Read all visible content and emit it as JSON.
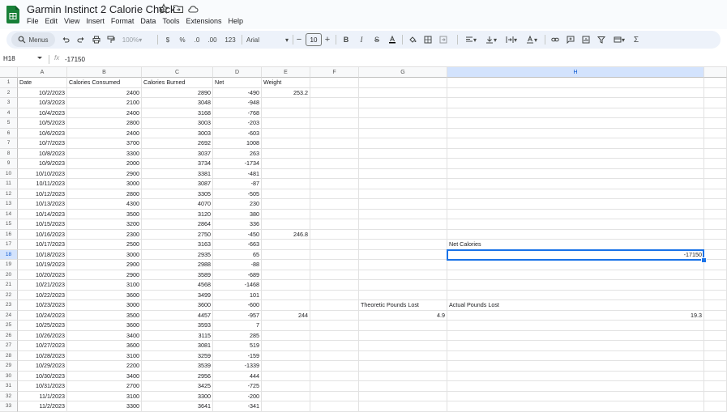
{
  "app": {
    "title": "Garmin Instinct 2 Calorie Check",
    "menus": [
      "File",
      "Edit",
      "View",
      "Insert",
      "Format",
      "Data",
      "Tools",
      "Extensions",
      "Help"
    ],
    "brand_color": "#188038"
  },
  "toolbar": {
    "menus_label": "Menus",
    "zoom": "100%",
    "currency": "$",
    "percent": "%",
    "dec_decrease": ".0",
    "dec_increase": ".00",
    "number_format": "123",
    "font": "Arial",
    "font_size": "10",
    "icons": [
      "undo-icon",
      "redo-icon",
      "print-icon",
      "paint-format-icon",
      "bold-icon",
      "italic-icon",
      "strikethrough-icon",
      "text-color-icon",
      "fill-color-icon",
      "borders-icon",
      "merge-icon",
      "h-align-icon",
      "v-align-icon",
      "wrap-icon",
      "rotate-icon",
      "link-icon",
      "comment-icon",
      "chart-icon",
      "filter-icon",
      "filter-views-icon",
      "functions-icon"
    ]
  },
  "formula_bar": {
    "name_box": "H18",
    "fx": "fx",
    "value": "-17150"
  },
  "grid": {
    "columns": [
      "A",
      "B",
      "C",
      "D",
      "E",
      "F",
      "G",
      "H"
    ],
    "selected_column": "H",
    "selected_row": "18",
    "row_numbers": [
      "1",
      "2",
      "3",
      "4",
      "5",
      "6",
      "7",
      "8",
      "9",
      "10",
      "11",
      "12",
      "13",
      "14",
      "15",
      "16",
      "17",
      "18",
      "19",
      "20",
      "21",
      "22",
      "23",
      "24",
      "25",
      "26",
      "27",
      "28",
      "29",
      "30",
      "31",
      "32",
      "33"
    ],
    "rows": [
      [
        "Date",
        "Calories Consumed",
        "Calories Burned",
        "Net",
        "Weight",
        "",
        "",
        ""
      ],
      [
        "10/2/2023",
        "2400",
        "2890",
        "-490",
        "253.2",
        "",
        "",
        ""
      ],
      [
        "10/3/2023",
        "2100",
        "3048",
        "-948",
        "",
        "",
        "",
        ""
      ],
      [
        "10/4/2023",
        "2400",
        "3168",
        "-768",
        "",
        "",
        "",
        ""
      ],
      [
        "10/5/2023",
        "2800",
        "3003",
        "-203",
        "",
        "",
        "",
        ""
      ],
      [
        "10/6/2023",
        "2400",
        "3003",
        "-603",
        "",
        "",
        "",
        ""
      ],
      [
        "10/7/2023",
        "3700",
        "2692",
        "1008",
        "",
        "",
        "",
        ""
      ],
      [
        "10/8/2023",
        "3300",
        "3037",
        "263",
        "",
        "",
        "",
        ""
      ],
      [
        "10/9/2023",
        "2000",
        "3734",
        "-1734",
        "",
        "",
        "",
        ""
      ],
      [
        "10/10/2023",
        "2900",
        "3381",
        "-481",
        "",
        "",
        "",
        ""
      ],
      [
        "10/11/2023",
        "3000",
        "3087",
        "-87",
        "",
        "",
        "",
        ""
      ],
      [
        "10/12/2023",
        "2800",
        "3305",
        "-505",
        "",
        "",
        "",
        ""
      ],
      [
        "10/13/2023",
        "4300",
        "4070",
        "230",
        "",
        "",
        "",
        ""
      ],
      [
        "10/14/2023",
        "3500",
        "3120",
        "380",
        "",
        "",
        "",
        ""
      ],
      [
        "10/15/2023",
        "3200",
        "2864",
        "336",
        "",
        "",
        "",
        ""
      ],
      [
        "10/16/2023",
        "2300",
        "2750",
        "-450",
        "246.8",
        "",
        "",
        ""
      ],
      [
        "10/17/2023",
        "2500",
        "3163",
        "-663",
        "",
        "",
        "",
        "Net Calories"
      ],
      [
        "10/18/2023",
        "3000",
        "2935",
        "65",
        "",
        "",
        "",
        "-17150"
      ],
      [
        "10/19/2023",
        "2900",
        "2988",
        "-88",
        "",
        "",
        "",
        ""
      ],
      [
        "10/20/2023",
        "2900",
        "3589",
        "-689",
        "",
        "",
        "",
        ""
      ],
      [
        "10/21/2023",
        "3100",
        "4568",
        "-1468",
        "",
        "",
        "",
        ""
      ],
      [
        "10/22/2023",
        "3600",
        "3499",
        "101",
        "",
        "",
        "",
        ""
      ],
      [
        "10/23/2023",
        "3000",
        "3600",
        "-600",
        "",
        "",
        "Theoretic Pounds Lost",
        "Actual Pounds Lost"
      ],
      [
        "10/24/2023",
        "3500",
        "4457",
        "-957",
        "244",
        "",
        "4.9",
        "19.3"
      ],
      [
        "10/25/2023",
        "3600",
        "3593",
        "7",
        "",
        "",
        "",
        ""
      ],
      [
        "10/26/2023",
        "3400",
        "3115",
        "285",
        "",
        "",
        "",
        ""
      ],
      [
        "10/27/2023",
        "3600",
        "3081",
        "519",
        "",
        "",
        "",
        ""
      ],
      [
        "10/28/2023",
        "3100",
        "3259",
        "-159",
        "",
        "",
        "",
        ""
      ],
      [
        "10/29/2023",
        "2200",
        "3539",
        "-1339",
        "",
        "",
        "",
        ""
      ],
      [
        "10/30/2023",
        "3400",
        "2956",
        "444",
        "",
        "",
        "",
        ""
      ],
      [
        "10/31/2023",
        "2700",
        "3425",
        "-725",
        "",
        "",
        "",
        ""
      ],
      [
        "11/1/2023",
        "3100",
        "3300",
        "-200",
        "",
        "",
        "",
        ""
      ],
      [
        "11/2/2023",
        "3300",
        "3641",
        "-341",
        "",
        "",
        "",
        ""
      ]
    ]
  }
}
